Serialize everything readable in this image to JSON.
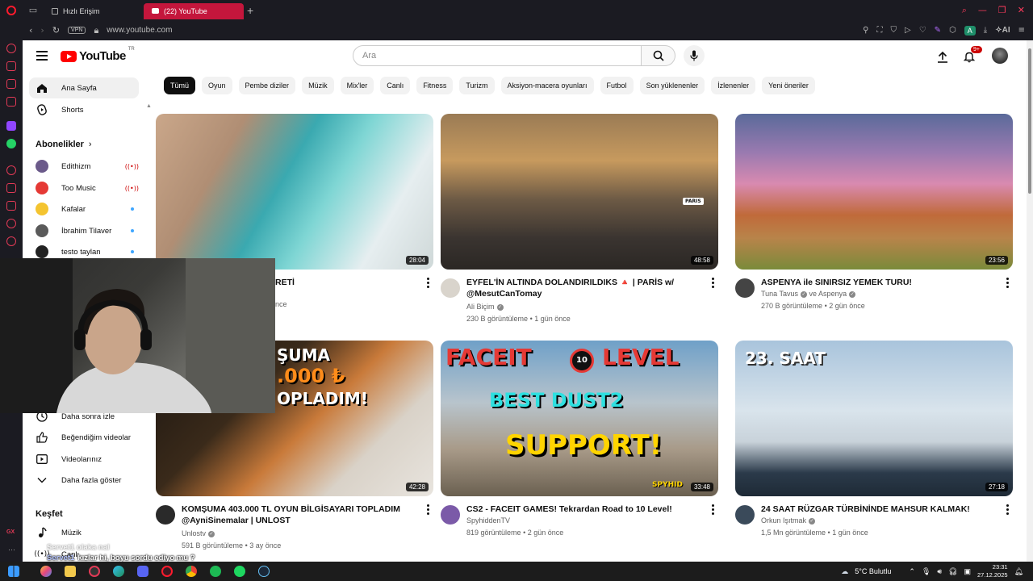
{
  "browser": {
    "tabs": [
      {
        "label": "Hızlı Erişim"
      },
      {
        "label": "(22) YouTube"
      }
    ],
    "vpn": "VPN",
    "url": "www.youtube.com",
    "ai_label": "AI",
    "profile_initial": "A"
  },
  "header": {
    "logo_text": "YouTube",
    "logo_region": "TR",
    "search_placeholder": "Ara",
    "notifications_badge": "9+"
  },
  "sidebar": {
    "main": [
      {
        "label": "Ana Sayfa",
        "icon": "home-icon"
      },
      {
        "label": "Shorts",
        "icon": "shorts-icon"
      }
    ],
    "subscriptions_heading": "Abonelikler",
    "subscriptions": [
      {
        "label": "Edithizm",
        "status": "live",
        "color": "#6b5a8a"
      },
      {
        "label": "Too Music",
        "status": "live",
        "color": "#e53935"
      },
      {
        "label": "Kafalar",
        "status": "new",
        "color": "#f4c430"
      },
      {
        "label": "İbrahim Tilaver",
        "status": "new",
        "color": "#5a5a5a"
      },
      {
        "label": "testo taylan",
        "status": "new",
        "color": "#222222"
      }
    ],
    "you_items": [
      {
        "label": "Daha sonra izle",
        "icon": "clock-icon"
      },
      {
        "label": "Beğendiğim videolar",
        "icon": "like-icon"
      },
      {
        "label": "Videolarınız",
        "icon": "video-icon"
      },
      {
        "label": "Daha fazla göster",
        "icon": "chevron-down-icon"
      }
    ],
    "explore_heading": "Keşfet",
    "explore": [
      {
        "label": "Müzik",
        "icon": "music-icon"
      },
      {
        "label": "Canlı",
        "icon": "live-icon"
      }
    ]
  },
  "chips": [
    "Tümü",
    "Oyun",
    "Pembe diziler",
    "Müzik",
    "Mix'ler",
    "Canlı",
    "Fitness",
    "Turizm",
    "Aksiyon-macera oyunları",
    "Futbol",
    "Son yüklenenler",
    "İzlenenler",
    "Yeni öneriler"
  ],
  "videos": [
    {
      "title_visible": "RETİ",
      "meta_visible": "nce",
      "duration": "28:04"
    },
    {
      "title": "EYFEL'İN ALTINDA DOLANDIRILDIKS 🔺 | PARİS w/ @MesutCanTomay",
      "channel": "Ali Biçim",
      "views": "230 B görüntüleme",
      "age": "1 gün önce",
      "duration": "48:58"
    },
    {
      "title": "ASPENYA ile SINIRSIZ YEMEK TURU!",
      "channel": "Tuna Tavus",
      "channel_extra": "ve Aspenya",
      "views": "270 B görüntüleme",
      "age": "2 gün önce",
      "duration": "23:56"
    },
    {
      "title": "KOMŞUMA 403.000 TL OYUN BİLGİSAYARI TOPLADIM @AyniSinemalar | UNLOST",
      "channel": "Unlostv",
      "views": "591 B görüntüleme",
      "age": "3 ay önce",
      "duration": "42:28",
      "thumb_text_1": "ŞUMA",
      "thumb_text_2": ".000 ₺",
      "thumb_text_3": "OPLADIM!"
    },
    {
      "title": "CS2 - FACEIT GAMES! Tekrardan Road to 10 Level!",
      "channel": "SpyhiddenTV",
      "views": "819 görüntüleme",
      "age": "2 gün önce",
      "duration": "33:48",
      "thumb_text_1": "FACEIT",
      "thumb_text_2": "LEVEL",
      "thumb_text_3": "BEST DUST2",
      "thumb_text_4": "SUPPORT!",
      "thumb_badge": "10",
      "thumb_brand": "SPYHID"
    },
    {
      "title": "24 SAAT RÜZGAR TÜRBİNİNDE MAHSUR KALMAK!",
      "channel": "Orkun Işıtmak",
      "views": "1,5 Mn görüntüleme",
      "age": "1 gün önce",
      "duration": "27:18",
      "thumb_text_1": "23. SAAT"
    }
  ],
  "thumb_tag_paris": "PARIS",
  "chat": {
    "ghost": "Servet1  olaka nal",
    "name": "Servet1",
    "message": "kızlar hi, boyu sordu ediyo mu ?"
  },
  "taskbar": {
    "weather": "5°C  Bulutlu",
    "time": "23:31",
    "date": "27.12.2025"
  }
}
